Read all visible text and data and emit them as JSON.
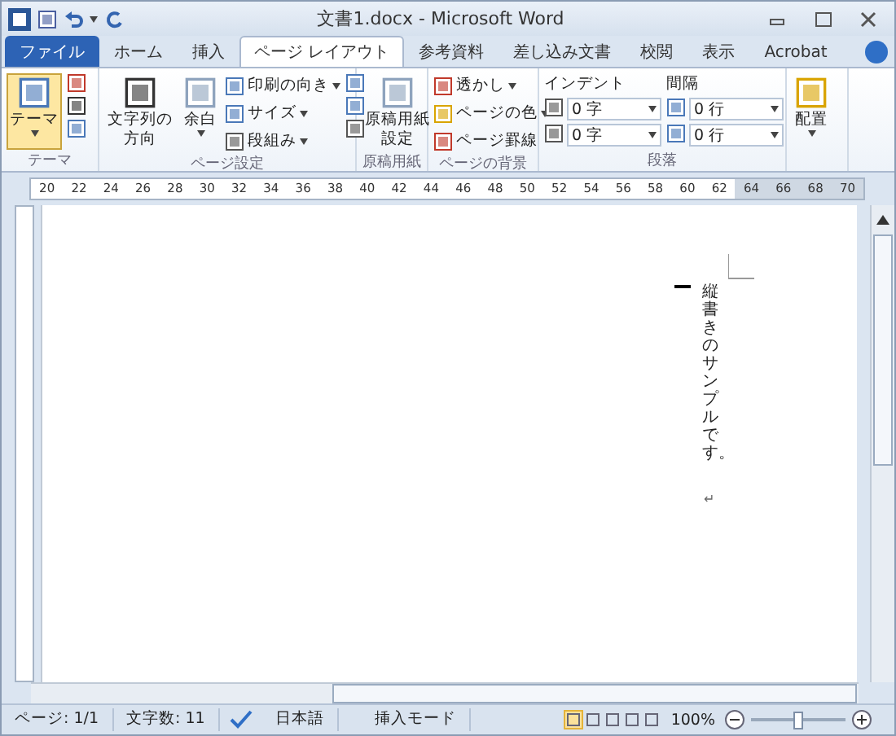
{
  "window": {
    "title": "文書1.docx - Microsoft Word"
  },
  "tabs": [
    {
      "label": "ファイル",
      "kind": "file",
      "selected": false
    },
    {
      "label": "ホーム",
      "kind": "tab",
      "selected": false
    },
    {
      "label": "挿入",
      "kind": "tab",
      "selected": false
    },
    {
      "label": "ページ レイアウト",
      "kind": "tab",
      "selected": true
    },
    {
      "label": "参考資料",
      "kind": "tab",
      "selected": false
    },
    {
      "label": "差し込み文書",
      "kind": "tab",
      "selected": false
    },
    {
      "label": "校閲",
      "kind": "tab",
      "selected": false
    },
    {
      "label": "表示",
      "kind": "tab",
      "selected": false
    },
    {
      "label": "Acrobat",
      "kind": "tab",
      "selected": false
    }
  ],
  "ribbon": {
    "theme": {
      "label": "テーマ",
      "button": "テーマ"
    },
    "page_setup": {
      "label": "ページ設定",
      "direction": [
        "文字列の",
        "方向"
      ],
      "margins": "余白",
      "orientation": "印刷の向き",
      "size": "サイズ",
      "columns": "段組み"
    },
    "manuscript": {
      "label": "原稿用紙",
      "button": [
        "原稿用紙",
        "設定"
      ]
    },
    "background": {
      "label": "ページの背景",
      "items": [
        "透かし",
        "ページの色",
        "ページ罫線"
      ]
    },
    "paragraph": {
      "label": "段落",
      "indent_label": "インデント",
      "indent": [
        "0 字",
        "0 字"
      ],
      "spacing_label": "間隔",
      "spacing": [
        "0 行",
        "0 行"
      ]
    },
    "arrange": {
      "button": "配置"
    }
  },
  "ruler": {
    "ticks": [
      {
        "label": "20",
        "shaded": false
      },
      {
        "label": "22",
        "shaded": false
      },
      {
        "label": "24",
        "shaded": false
      },
      {
        "label": "26",
        "shaded": false
      },
      {
        "label": "28",
        "shaded": false
      },
      {
        "label": "30",
        "shaded": false
      },
      {
        "label": "32",
        "shaded": false
      },
      {
        "label": "34",
        "shaded": false
      },
      {
        "label": "36",
        "shaded": false
      },
      {
        "label": "38",
        "shaded": false
      },
      {
        "label": "40",
        "shaded": false
      },
      {
        "label": "42",
        "shaded": false
      },
      {
        "label": "44",
        "shaded": false
      },
      {
        "label": "46",
        "shaded": false
      },
      {
        "label": "48",
        "shaded": false
      },
      {
        "label": "50",
        "shaded": false
      },
      {
        "label": "52",
        "shaded": false
      },
      {
        "label": "54",
        "shaded": false
      },
      {
        "label": "56",
        "shaded": false
      },
      {
        "label": "58",
        "shaded": false
      },
      {
        "label": "60",
        "shaded": false
      },
      {
        "label": "62",
        "shaded": false
      },
      {
        "label": "64",
        "shaded": true
      },
      {
        "label": "66",
        "shaded": true
      },
      {
        "label": "68",
        "shaded": true
      },
      {
        "label": "70",
        "shaded": true
      }
    ]
  },
  "document": {
    "text": "縦書きのサンプルです。",
    "mark": "↵"
  },
  "status_bar": {
    "page": "ページ: 1/1",
    "words": "文字数: 11",
    "language": "日本語",
    "mode": "挿入モード",
    "views": [
      {
        "selected": true
      },
      {
        "selected": false
      },
      {
        "selected": false
      },
      {
        "selected": false
      },
      {
        "selected": false
      }
    ],
    "zoom": "100%",
    "zoom_level": {
      "level": 0.5
    }
  }
}
